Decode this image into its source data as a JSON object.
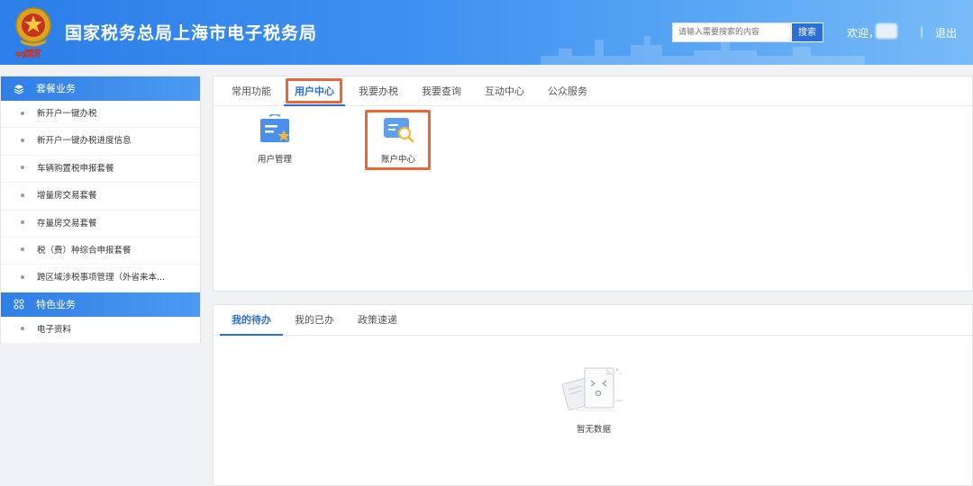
{
  "header": {
    "title": "国家税务总局上海市电子税务局",
    "search_placeholder": "请输入需要搜索的内容",
    "search_button": "搜索",
    "welcome": "欢迎，",
    "separator": "|",
    "logout": "退出",
    "emblem_caption": "中国税务"
  },
  "sidebar": {
    "sections": [
      {
        "title": "套餐业务",
        "icon": "layers-icon",
        "items": [
          "新开户一键办税",
          "新开户一键办税进度信息",
          "车辆购置税申报套餐",
          "增量房交易套餐",
          "存量房交易套餐",
          "税（费）种综合申报套餐",
          "跨区域涉税事项管理（外省来本..."
        ]
      },
      {
        "title": "特色业务",
        "icon": "grid-icon",
        "items": [
          "电子资料"
        ]
      }
    ]
  },
  "main": {
    "tabs": [
      "常用功能",
      "用户中心",
      "我要办税",
      "我要查询",
      "互动中心",
      "公众服务"
    ],
    "active_tab": "用户中心",
    "apps": [
      {
        "label": "用户管理",
        "icon": "user-management-icon"
      },
      {
        "label": "账户中心",
        "icon": "account-center-icon"
      }
    ]
  },
  "bottom": {
    "tabs": [
      "我的待办",
      "我的已办",
      "政策速递"
    ],
    "active_tab": "我的待办",
    "empty_text": "暂无数据"
  },
  "colors": {
    "primary": "#2b6fd6",
    "highlight": "#e8683a",
    "header_gradient_start": "#2c7ee8",
    "header_gradient_end": "#78bbf7"
  }
}
